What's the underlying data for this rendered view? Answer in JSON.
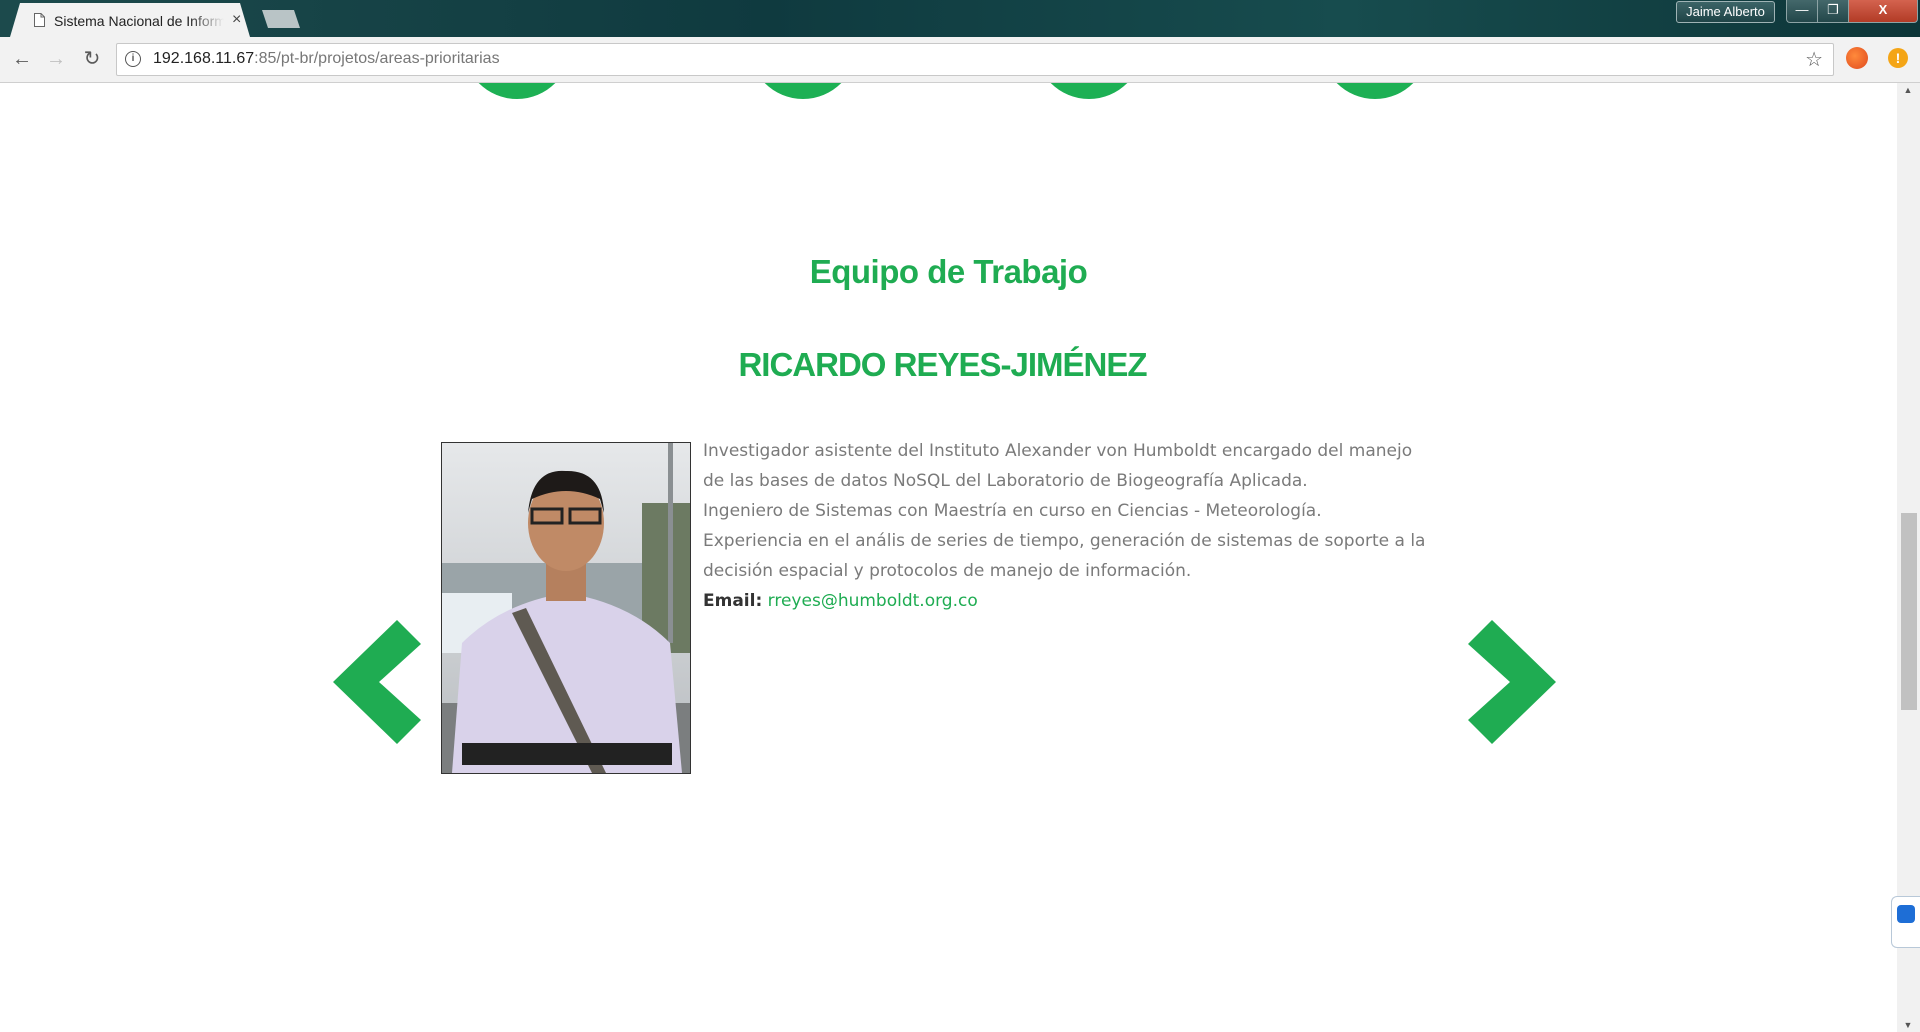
{
  "browser": {
    "tab_title": "Sistema Nacional de Información sobre Biodiversidad",
    "tab_close": "×",
    "profile_name": "Jaime Alberto",
    "window_controls": {
      "minimize": "—",
      "maximize": "❐",
      "close": "X"
    },
    "url_host": "192.168.11.67",
    "url_path": ":85/pt-br/projetos/areas-prioritarias",
    "nav": {
      "back": "←",
      "forward": "→",
      "reload": "↻"
    },
    "star": "☆",
    "ext2_label": "!"
  },
  "page": {
    "section_title": "Equipo de Trabajo",
    "member": {
      "name": "RICARDO REYES-JIMÉNEZ",
      "bio_lines": [
        "Investigador asistente del Instituto Alexander von Humboldt encargado del manejo de las bases de datos NoSQL del Laboratorio de Biogeografía Aplicada.",
        "Ingeniero de Sistemas con Maestría en curso en Ciencias - Meteorología.",
        "Experiencia en el anális de series de tiempo, generación de sistemas de soporte a la decisión espacial y protocolos de manejo de información."
      ],
      "email_label": "Email:",
      "email": "rreyes@humboldt.org.co"
    }
  },
  "colors": {
    "brand_green": "#1fac52",
    "circle_green": "#1db054",
    "body_text": "#7a7a7a"
  },
  "icons": {
    "prev": "chevron-left-icon",
    "next": "chevron-right-icon",
    "favicon": "document-icon",
    "info": "info-icon",
    "bookmark": "star-icon"
  }
}
